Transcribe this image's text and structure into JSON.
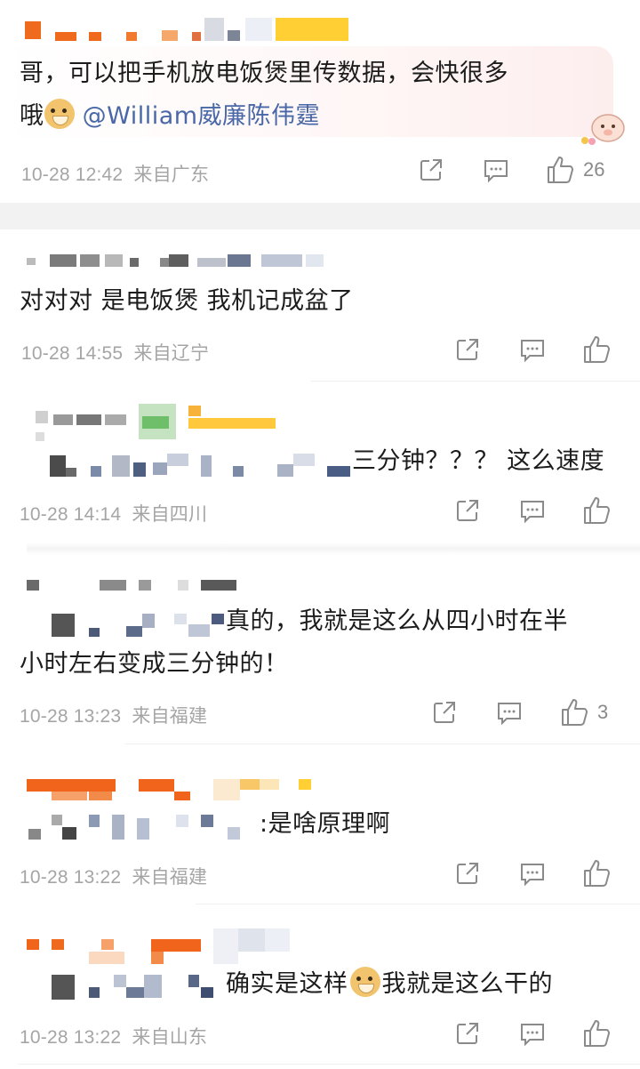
{
  "comments": [
    {
      "text_before": "哥，可以把手机放电饭煲里传数据，会快很多",
      "text_line2_prefix": "哦",
      "mention": "@William威廉陈伟霆",
      "time": "10-28 12:42",
      "location": "来自广东",
      "likes": "26"
    },
    {
      "text": "对对对 是电饭煲 我机记成盆了",
      "time": "10-28 14:55",
      "location": "来自辽宁",
      "likes": ""
    },
    {
      "text": "三分钟？？？ 这么速度",
      "time": "10-28 14:14",
      "location": "来自四川",
      "likes": ""
    },
    {
      "text_line1": "真的，我就是这么从四小时在半",
      "text_line2": "小时左右变成三分钟的！",
      "time": "10-28 13:23",
      "location": "来自福建",
      "likes": "3"
    },
    {
      "text": ":是啥原理啊",
      "time": "10-28 13:22",
      "location": "来自福建",
      "likes": ""
    },
    {
      "text_before": "确实是这样",
      "text_after": "我就是这么干的",
      "time": "10-28 13:22",
      "location": "来自山东",
      "likes": ""
    }
  ],
  "icons": {
    "share": "share-icon",
    "comment": "comment-icon",
    "like": "thumbs-up-icon",
    "emoji": "doge-emoji-icon"
  },
  "colors": {
    "mention": "#4a68a8",
    "meta": "#a5a5a5",
    "icon": "#8a8a8a"
  }
}
